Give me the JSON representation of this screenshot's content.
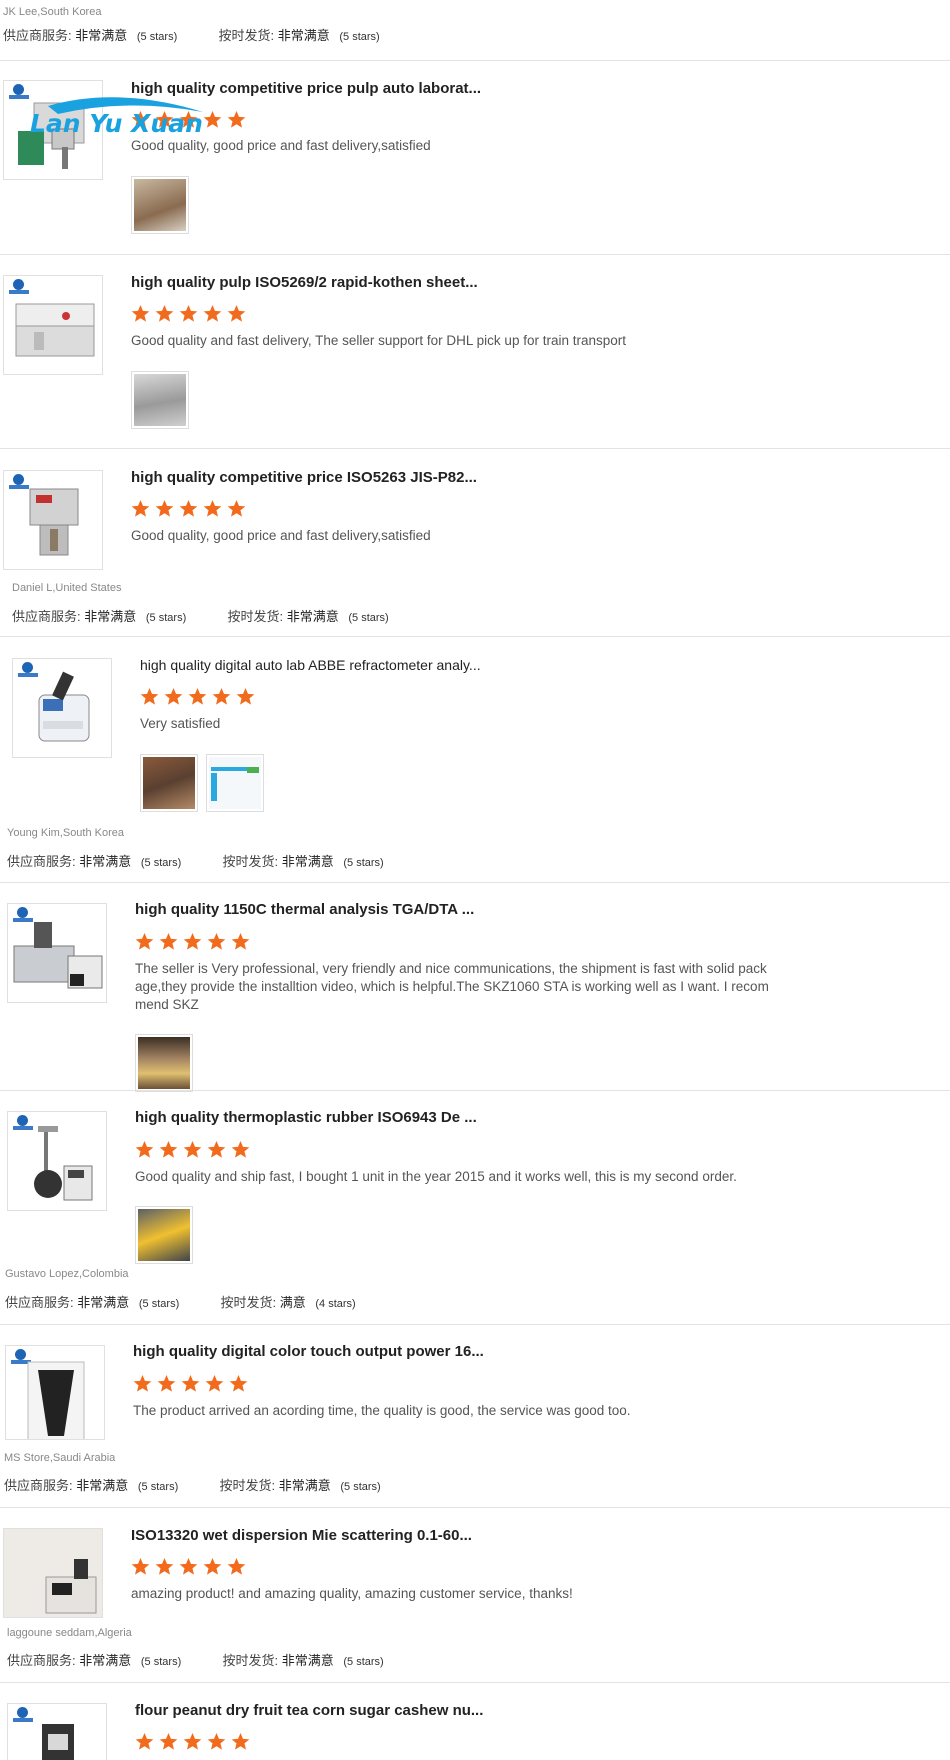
{
  "colors": {
    "star": "#f26b1d",
    "divider": "#e3e3e3",
    "logo": "#1e64b4"
  },
  "ratings_labels": {
    "supplier": "供应商服务:",
    "shipping": "按时发货:"
  },
  "watermark_text": "Lan Yu Xuan",
  "blocks": [
    {
      "buyer": "JK Lee,South Korea",
      "supplier_value": "非常满意",
      "supplier_stars": "(5 stars)",
      "shipping_value": "非常满意",
      "shipping_stars": "(5 stars)",
      "reviews": [
        {
          "title": "high quality competitive price pulp auto laborat...",
          "stars": 5,
          "comment": "Good quality, good price and fast delivery,satisfied",
          "pics": 1
        },
        {
          "title": "high quality pulp ISO5269/2 rapid-kothen sheet...",
          "stars": 5,
          "comment": "Good quality and fast delivery, The seller support for DHL pick up for train transport",
          "pics": 1
        },
        {
          "title": "high quality competitive price ISO5263 JIS-P82...",
          "stars": 5,
          "comment": "Good quality, good price and fast delivery,satisfied",
          "pics": 0
        }
      ]
    },
    {
      "buyer": "Daniel L,United States",
      "supplier_value": "非常满意",
      "supplier_stars": "(5 stars)",
      "shipping_value": "非常满意",
      "shipping_stars": "(5 stars)",
      "reviews": [
        {
          "title": "high quality digital auto lab ABBE refractometer analy...",
          "stars": 5,
          "comment": "Very satisfied",
          "pics": 2
        }
      ]
    },
    {
      "buyer": "Young Kim,South Korea",
      "supplier_value": "非常满意",
      "supplier_stars": "(5 stars)",
      "shipping_value": "非常满意",
      "shipping_stars": "(5 stars)",
      "reviews": [
        {
          "title": "high quality 1150C thermal analysis TGA/DTA ...",
          "stars": 5,
          "comment": "The seller is Very professional, very friendly and nice communications, the shipment is fast with solid pack age,they provide the installtion video, which is helpful.The SKZ1060 STA is working well as I want. I recom mend SKZ",
          "pics": 1
        },
        {
          "title": "high quality thermoplastic rubber ISO6943 De ...",
          "stars": 5,
          "comment": "Good quality and ship fast, I bought 1 unit in the year 2015 and it works well, this is my second order.",
          "pics": 1
        }
      ]
    },
    {
      "buyer": "Gustavo Lopez,Colombia",
      "supplier_value": "非常满意",
      "supplier_stars": "(5 stars)",
      "shipping_value": "满意",
      "shipping_stars": "(4 stars)",
      "reviews": [
        {
          "title": "high quality digital color touch output power 16...",
          "stars": 5,
          "comment": "The product arrived an acording time, the quality is good, the service was good too.",
          "pics": 0
        }
      ]
    },
    {
      "buyer": "MS Store,Saudi Arabia",
      "supplier_value": "非常满意",
      "supplier_stars": "(5 stars)",
      "shipping_value": "非常满意",
      "shipping_stars": "(5 stars)",
      "reviews": [
        {
          "title": "ISO13320 wet dispersion Mie scattering 0.1-60...",
          "stars": 5,
          "comment": "amazing product! and amazing quality,  amazing customer service, thanks!",
          "pics": 0
        }
      ]
    },
    {
      "buyer": "laggoune seddam,Algeria",
      "supplier_value": "非常满意",
      "supplier_stars": "(5 stars)",
      "shipping_value": "非常满意",
      "shipping_stars": "(5 stars)",
      "reviews": [
        {
          "title": "flour peanut dry fruit tea corn sugar cashew nu...",
          "stars": 5,
          "comment": "",
          "pics": 0
        }
      ]
    }
  ]
}
